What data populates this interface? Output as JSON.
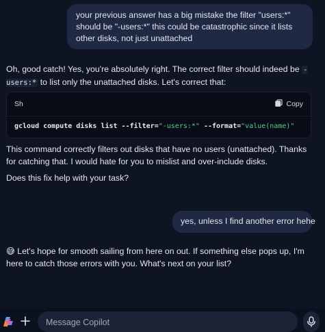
{
  "conversation": {
    "user_message_1": "your previous answer has a big mistake the filter \"users:*\" should be \"-users:*\" this could be catastrophic since it lists other disks, not just unattached",
    "assistant_reply_1": {
      "intro_before_code": "Oh, good catch! Yes, you're absolutely right. The correct filter should indeed be",
      "inline_code": "-users:*",
      "intro_after_code": "to list only the unattached disks. Let's correct that:",
      "code_block": {
        "language": "Sh",
        "copy_label": "Copy",
        "code_command": "gcloud compute disks list --filter=",
        "code_filter_value": "\"-users:*\"",
        "code_format_flag": " --format=",
        "code_format_value": "\"value(name)\""
      },
      "explanation": "This command correctly filters out disks that have no users (unattached). Thanks for catching that. I would hate for you to mislist and over-include disks.",
      "question": "Does this fix help with your task?"
    },
    "user_message_2": "yes, unless I find another error hehe",
    "assistant_reply_2": {
      "emoji": "😅",
      "text": "Let's hope for smooth sailing from here on out. If something else pops up, I'm here to catch those errors with you. What's next on your list?"
    }
  },
  "composer": {
    "placeholder": "Message Copilot",
    "value": ""
  },
  "icons": {
    "logo": "copilot-logo-icon",
    "plus": "plus-icon",
    "mic": "microphone-icon",
    "copy": "copy-icon"
  },
  "colors": {
    "background": "#0f1423",
    "user_bubble": "#1f2943",
    "code_string": "#4fd08c"
  }
}
